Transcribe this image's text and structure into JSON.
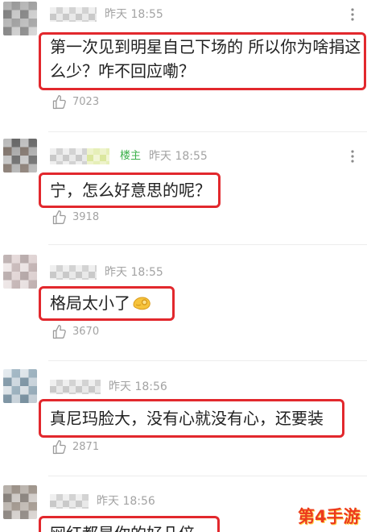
{
  "colors": {
    "highlight_border": "#e2282d",
    "op_badge": "#3bb04a",
    "meta_text": "#a3a3a3",
    "comment_text": "#222222",
    "watermark": "#ec3a1c"
  },
  "icons": {
    "more": "more-icon",
    "like": "thumbs-up-icon"
  },
  "comments": [
    {
      "time": "昨天 18:55",
      "lines": [
        "第一次见到明星自己下场的 所以你为啥捐这",
        "么少？咋不回应嘞？"
      ],
      "likes": "7023"
    },
    {
      "badge": "楼主",
      "time": "昨天 18:55",
      "lines": [
        "宁，怎么好意思的呢？"
      ],
      "likes": "3918"
    },
    {
      "time": "昨天 18:55",
      "lines": [
        "格局太小了"
      ],
      "emoji": "ok-hand-emoji",
      "likes": "3670"
    },
    {
      "time": "昨天 18:56",
      "lines": [
        "真尼玛脸大，没有心就没有心，还要装"
      ],
      "likes": "2871"
    },
    {
      "time": "昨天 18:56",
      "lines": [
        "网红都是你的好几倍"
      ]
    }
  ],
  "watermark": "第4手游"
}
